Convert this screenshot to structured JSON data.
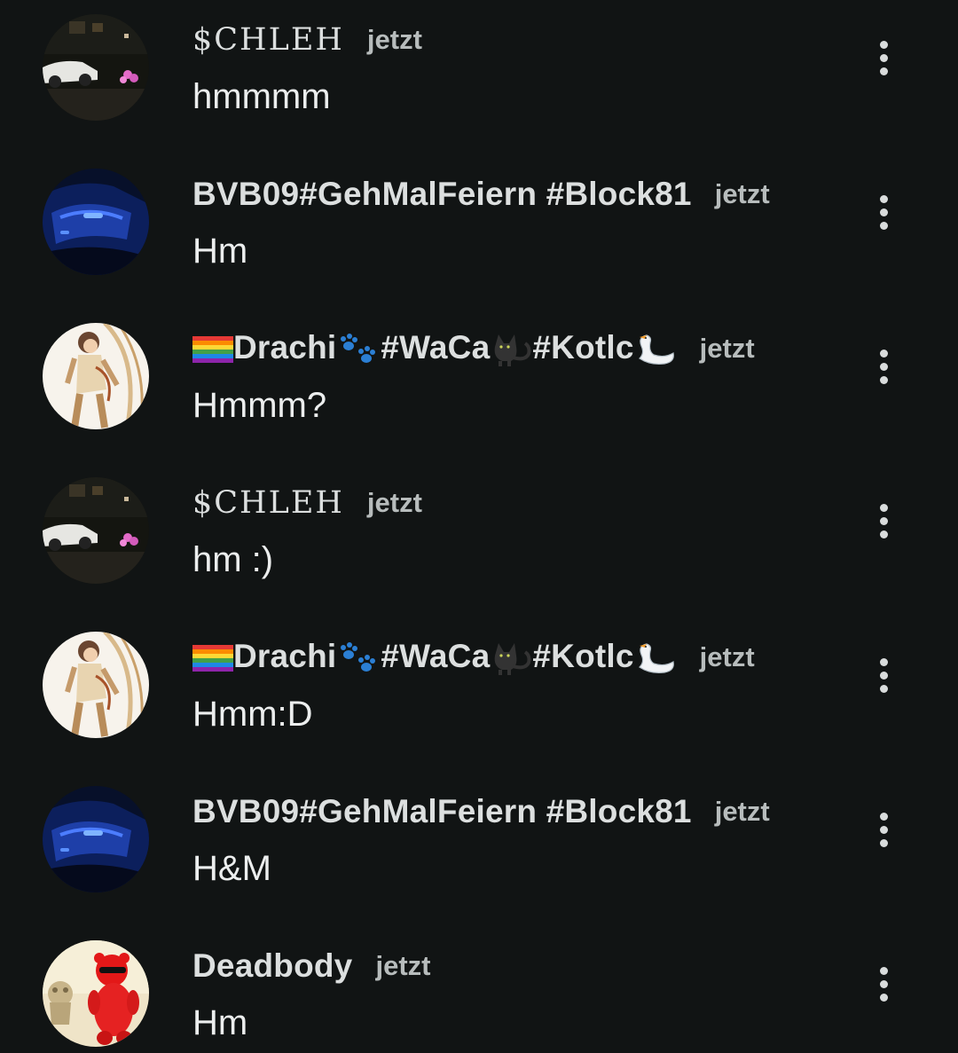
{
  "comments": [
    {
      "username": "$CHLEH",
      "time": "jetzt",
      "text": "hmmmm",
      "avatar": "car-night-avatar"
    },
    {
      "username": "BVB09#GehMalFeiern #Block81",
      "time": "jetzt",
      "text": "Hm",
      "avatar": "blue-motorbike-avatar"
    },
    {
      "username_parts": [
        "Drachi",
        "#WaCa",
        "#Kotlc"
      ],
      "time": "jetzt",
      "text": "Hmmm?",
      "avatar": "anime-character-avatar"
    },
    {
      "username": "$CHLEH",
      "time": "jetzt",
      "text": "hm :)",
      "avatar": "car-night-avatar"
    },
    {
      "username_parts": [
        "Drachi",
        "#WaCa",
        "#Kotlc"
      ],
      "time": "jetzt",
      "text": "Hmm:D",
      "avatar": "anime-character-avatar"
    },
    {
      "username": "BVB09#GehMalFeiern #Block81",
      "time": "jetzt",
      "text": "H&M",
      "avatar": "blue-motorbike-avatar"
    },
    {
      "username": "Deadbody",
      "time": "jetzt",
      "text": "Hm",
      "avatar": "red-gummy-bear-avatar"
    }
  ],
  "icons": {
    "more": "vertical-ellipsis-icon",
    "flag": "rainbow-flag-icon",
    "paw": "paw-prints-icon",
    "cat": "black-cat-icon",
    "swan": "swan-icon"
  },
  "colors": {
    "background": "#111414",
    "text": "#eceeee",
    "muted": "#b7bcbc"
  }
}
